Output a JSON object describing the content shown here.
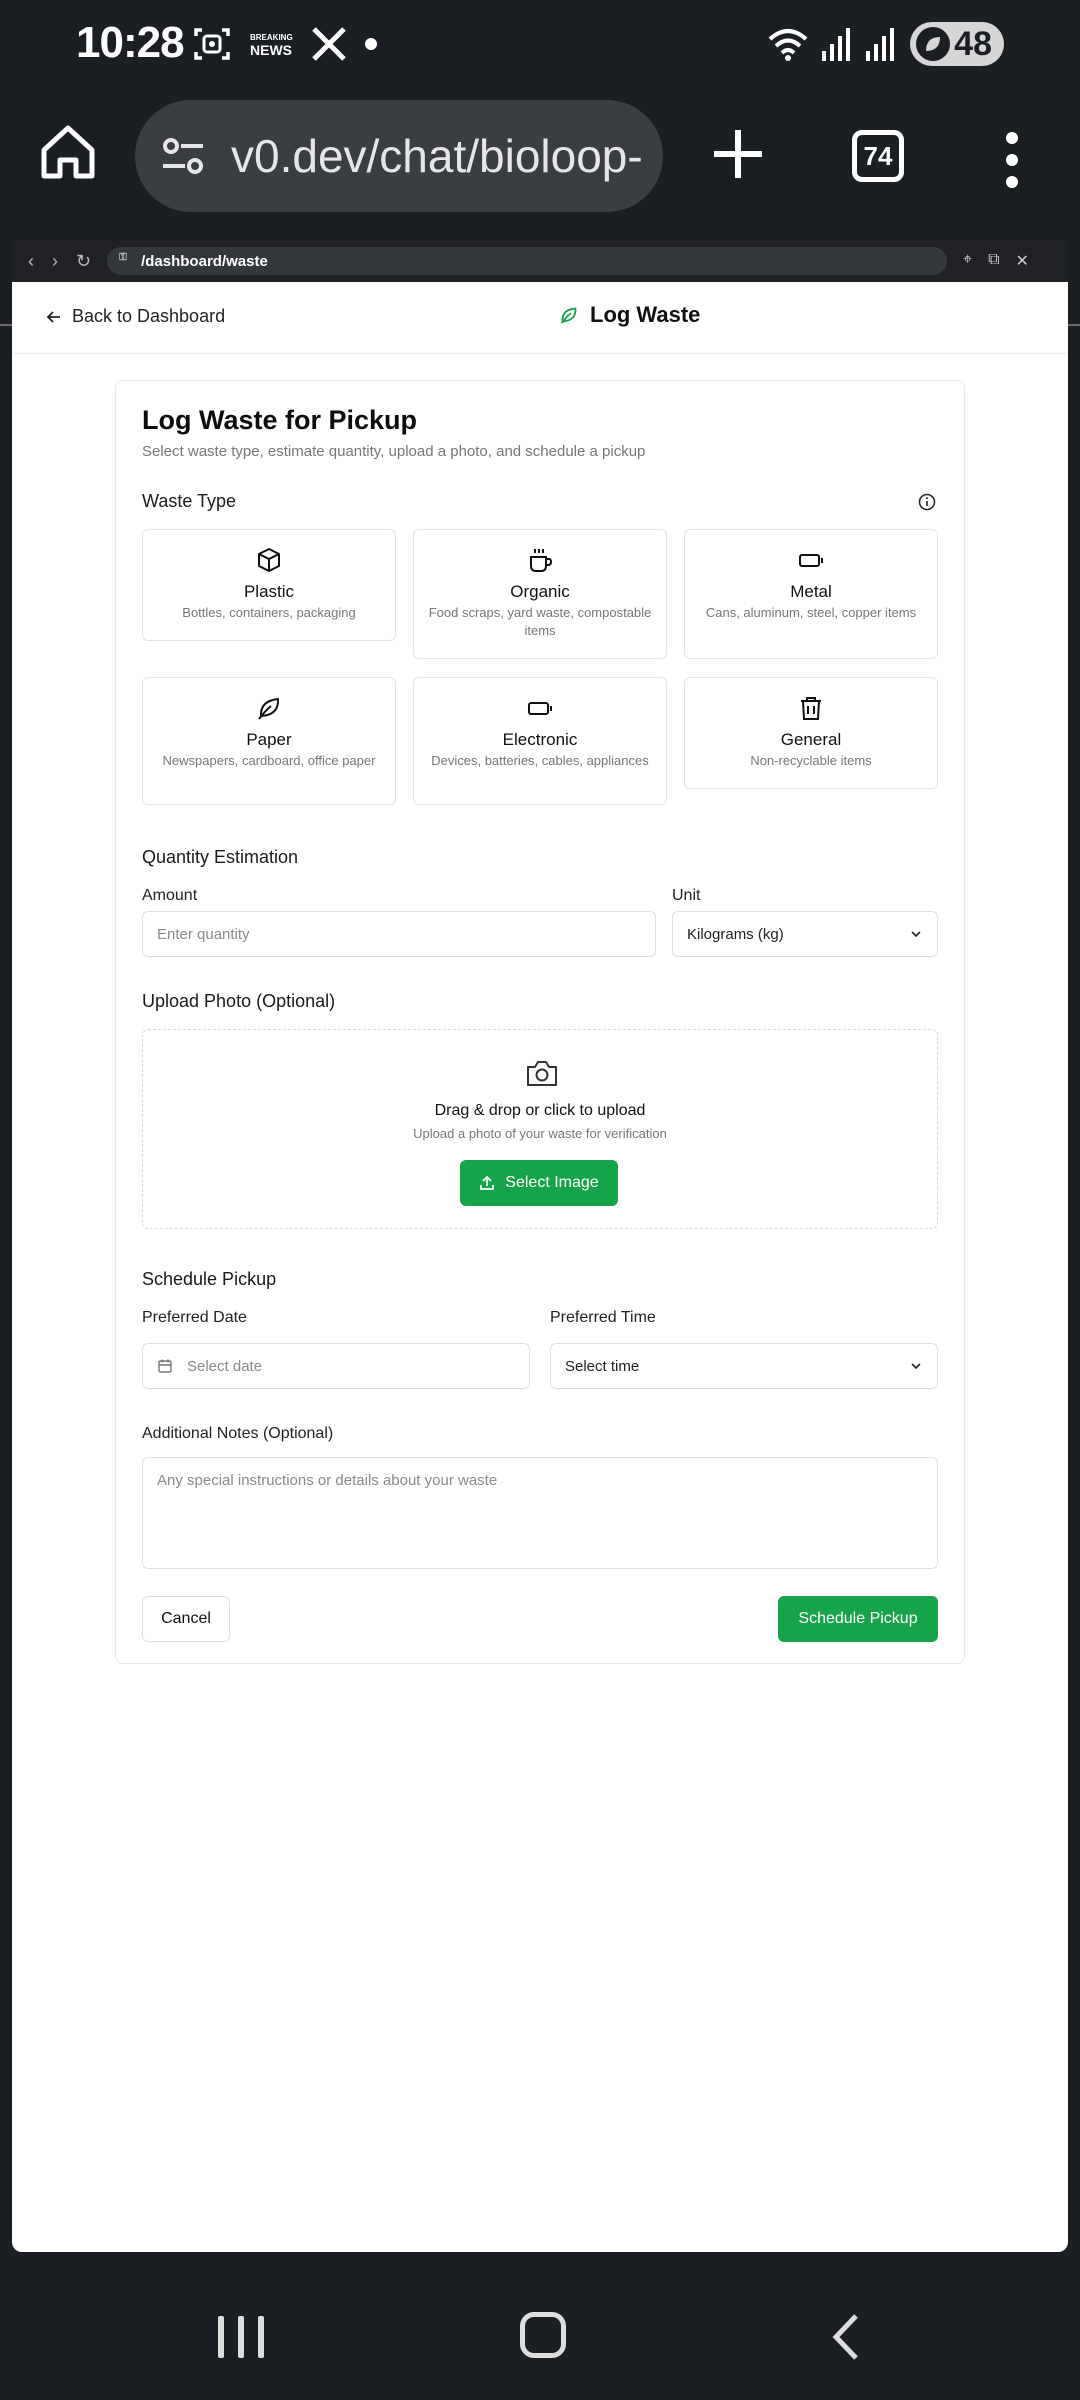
{
  "status": {
    "time": "10:28",
    "news_top": "BREAKING",
    "news_bottom": "NEWS",
    "battery": "48"
  },
  "browser": {
    "url": "v0.dev/chat/bioloop-",
    "tab_count": "74"
  },
  "preview": {
    "url": "/dashboard/waste"
  },
  "header": {
    "back_label": "Back to Dashboard",
    "title": "Log Waste"
  },
  "form": {
    "title": "Log Waste for Pickup",
    "subtitle": "Select waste type, estimate quantity, upload a photo, and schedule a pickup",
    "waste_type_label": "Waste Type",
    "waste_types": [
      {
        "name": "Plastic",
        "desc": "Bottles, containers, packaging",
        "icon": "box-icon"
      },
      {
        "name": "Organic",
        "desc": "Food scraps, yard waste, compostable items",
        "icon": "cup-icon"
      },
      {
        "name": "Metal",
        "desc": "Cans, aluminum, steel, copper items",
        "icon": "battery-icon"
      },
      {
        "name": "Paper",
        "desc": "Newspapers, cardboard, office paper",
        "icon": "leaf-icon"
      },
      {
        "name": "Electronic",
        "desc": "Devices, batteries, cables, appliances",
        "icon": "battery-icon"
      },
      {
        "name": "General",
        "desc": "Non-recyclable items",
        "icon": "trash-icon"
      }
    ],
    "quantity_label": "Quantity Estimation",
    "amount_label": "Amount",
    "amount_placeholder": "Enter quantity",
    "unit_label": "Unit",
    "unit_value": "Kilograms (kg)",
    "upload_label": "Upload Photo (Optional)",
    "upload_title": "Drag & drop or click to upload",
    "upload_sub": "Upload a photo of your waste for verification",
    "select_image": "Select Image",
    "schedule_label": "Schedule Pickup",
    "date_label": "Preferred Date",
    "date_placeholder": "Select date",
    "time_label": "Preferred Time",
    "time_placeholder": "Select time",
    "notes_label": "Additional Notes (Optional)",
    "notes_placeholder": "Any special instructions or details about your waste",
    "cancel": "Cancel",
    "submit": "Schedule Pickup"
  },
  "colors": {
    "accent": "#17a34a",
    "system_bg": "#1b1e22"
  }
}
